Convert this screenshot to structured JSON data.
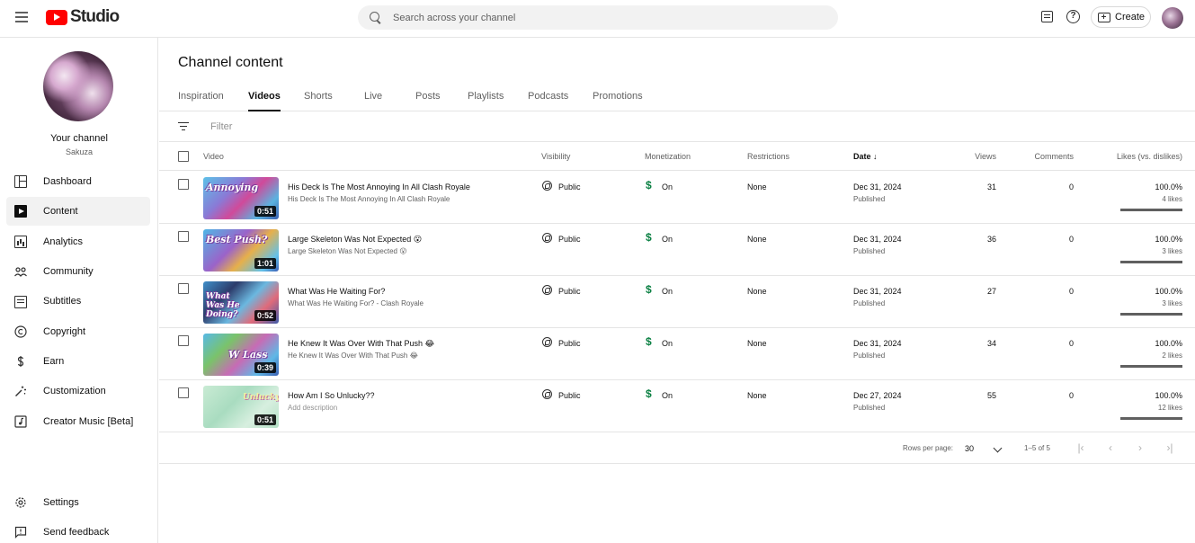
{
  "header": {
    "logo_text": "Studio",
    "search_placeholder": "Search across your channel",
    "create_label": "Create",
    "help_glyph": "?"
  },
  "sidebar": {
    "your_channel": "Your channel",
    "channel_name": "Sakuza",
    "items": [
      {
        "label": "Dashboard",
        "icon": "dashboard-icon"
      },
      {
        "label": "Content",
        "icon": "content-icon"
      },
      {
        "label": "Analytics",
        "icon": "analytics-icon"
      },
      {
        "label": "Community",
        "icon": "community-icon"
      },
      {
        "label": "Subtitles",
        "icon": "subtitles-icon"
      },
      {
        "label": "Copyright",
        "icon": "copyright-icon"
      },
      {
        "label": "Earn",
        "icon": "earn-icon"
      },
      {
        "label": "Customization",
        "icon": "customization-icon"
      },
      {
        "label": "Creator Music [Beta]",
        "icon": "creator-music-icon"
      }
    ],
    "bottom_items": [
      {
        "label": "Settings",
        "icon": "gear-icon"
      },
      {
        "label": "Send feedback",
        "icon": "feedback-icon"
      }
    ]
  },
  "main": {
    "title": "Channel content",
    "tabs": [
      "Inspiration",
      "Videos",
      "Shorts",
      "Live",
      "Posts",
      "Playlists",
      "Podcasts",
      "Promotions"
    ],
    "active_tab": "Videos",
    "filter_placeholder": "Filter",
    "columns": {
      "video": "Video",
      "visibility": "Visibility",
      "monetization": "Monetization",
      "restrictions": "Restrictions",
      "date": "Date",
      "views": "Views",
      "comments": "Comments",
      "likes": "Likes (vs. dislikes)"
    },
    "videos": [
      {
        "title": "His Deck Is The Most Annoying In All Clash Royale",
        "description": "His Deck Is The Most Annoying In All Clash Royale",
        "thumb_text": "Annoying",
        "duration": "0:51",
        "visibility": "Public",
        "monetization": "On",
        "restrictions": "None",
        "date": "Dec 31, 2024",
        "status": "Published",
        "views": "31",
        "comments": "0",
        "likes_pct": "100.0%",
        "likes_count": "4 likes",
        "likes_ratio": 1.0
      },
      {
        "title": "Large Skeleton Was Not Expected 😮",
        "description": "Large Skeleton Was Not Expected 😮",
        "thumb_text": "Best Push?",
        "duration": "1:01",
        "visibility": "Public",
        "monetization": "On",
        "restrictions": "None",
        "date": "Dec 31, 2024",
        "status": "Published",
        "views": "36",
        "comments": "0",
        "likes_pct": "100.0%",
        "likes_count": "3 likes",
        "likes_ratio": 1.0
      },
      {
        "title": "What Was He Waiting For?",
        "description": "What Was He Waiting For? - Clash Royale",
        "thumb_text": "What Was He Doing?",
        "duration": "0:52",
        "visibility": "Public",
        "monetization": "On",
        "restrictions": "None",
        "date": "Dec 31, 2024",
        "status": "Published",
        "views": "27",
        "comments": "0",
        "likes_pct": "100.0%",
        "likes_count": "3 likes",
        "likes_ratio": 1.0
      },
      {
        "title": "He Knew It Was Over With That Push 😂",
        "description": "He Knew It Was Over With That Push 😂",
        "thumb_text": "W Lass",
        "duration": "0:39",
        "visibility": "Public",
        "monetization": "On",
        "restrictions": "None",
        "date": "Dec 31, 2024",
        "status": "Published",
        "views": "34",
        "comments": "0",
        "likes_pct": "100.0%",
        "likes_count": "2 likes",
        "likes_ratio": 1.0
      },
      {
        "title": "How Am I So Unlucky??",
        "description": "Add description",
        "thumb_text": "Unlucky",
        "duration": "0:51",
        "visibility": "Public",
        "monetization": "On",
        "restrictions": "None",
        "date": "Dec 27, 2024",
        "status": "Published",
        "views": "55",
        "comments": "0",
        "likes_pct": "100.0%",
        "likes_count": "12 likes",
        "likes_ratio": 1.0
      }
    ],
    "pagination": {
      "rows_label": "Rows per page:",
      "rows_value": "30",
      "range": "1–5 of 5"
    }
  },
  "colors": {
    "brand_red": "#ff0000",
    "monetization_green": "#0b8043"
  }
}
